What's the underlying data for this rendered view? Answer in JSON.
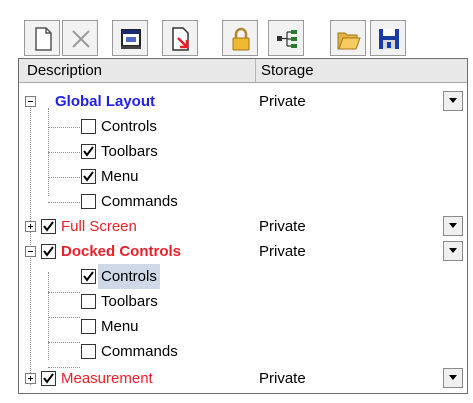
{
  "toolbar": {
    "buttons": [
      {
        "name": "new-document-icon"
      },
      {
        "name": "delete-icon"
      },
      {
        "name": "window-icon"
      },
      {
        "name": "export-icon"
      },
      {
        "name": "lock-icon"
      },
      {
        "name": "tree-structure-icon"
      },
      {
        "name": "open-folder-icon"
      },
      {
        "name": "save-icon"
      }
    ]
  },
  "header": {
    "description": "Description",
    "storage": "Storage"
  },
  "tree": [
    {
      "label": "Global Layout",
      "style": "blue",
      "storage": "Private",
      "expanded": true,
      "children": [
        {
          "label": "Controls",
          "checked": false
        },
        {
          "label": "Toolbars",
          "checked": true
        },
        {
          "label": "Menu",
          "checked": true
        },
        {
          "label": "Commands",
          "checked": false
        }
      ]
    },
    {
      "label": "Full Screen",
      "style": "red",
      "storage": "Private",
      "checked": true,
      "expanded": false
    },
    {
      "label": "Docked Controls",
      "style": "red-bold",
      "storage": "Private",
      "checked": true,
      "expanded": true,
      "children": [
        {
          "label": "Controls",
          "checked": true,
          "selected": true
        },
        {
          "label": "Toolbars",
          "checked": false
        },
        {
          "label": "Menu",
          "checked": false
        },
        {
          "label": "Commands",
          "checked": false
        }
      ]
    },
    {
      "label": "Measurement",
      "style": "red",
      "storage": "Private",
      "checked": true,
      "expanded": false
    }
  ]
}
